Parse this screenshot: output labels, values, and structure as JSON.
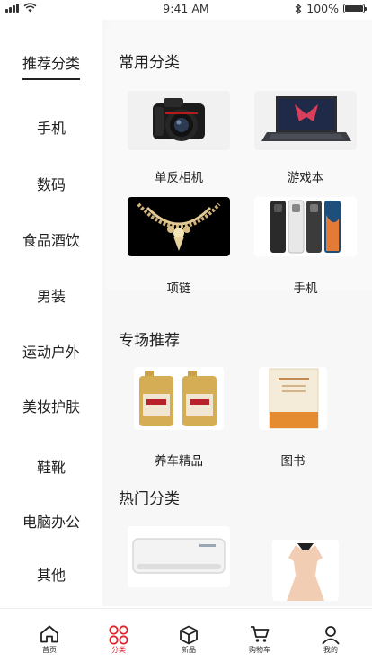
{
  "status_bar": {
    "time": "9:41 AM",
    "battery_percent": "100%",
    "battery_level": 1.0
  },
  "sidebar": {
    "items": [
      {
        "label": "推荐分类",
        "active": true
      },
      {
        "label": "手机"
      },
      {
        "label": "数码"
      },
      {
        "label": "食品酒饮"
      },
      {
        "label": "男装"
      },
      {
        "label": "运动户外"
      },
      {
        "label": "美妆护肤"
      },
      {
        "label": "鞋靴"
      },
      {
        "label": "电脑办公"
      },
      {
        "label": "其他"
      }
    ]
  },
  "sections": {
    "common": {
      "title": "常用分类",
      "items": [
        {
          "label": "单反相机",
          "icon": "camera-image"
        },
        {
          "label": "游戏本",
          "icon": "laptop-image"
        },
        {
          "label": "项链",
          "icon": "necklace-image"
        },
        {
          "label": "手机",
          "icon": "phone-image"
        }
      ]
    },
    "special": {
      "title": "专场推荐",
      "items": [
        {
          "label": "养车精品",
          "icon": "engine-oil-image"
        },
        {
          "label": "图书",
          "icon": "book-image"
        }
      ]
    },
    "hot": {
      "title": "热门分类",
      "items": [
        {
          "icon": "air-conditioner-image"
        },
        {
          "icon": "dress-image"
        }
      ]
    }
  },
  "tabbar": {
    "items": [
      {
        "label": "首页",
        "icon": "home-icon"
      },
      {
        "label": "分类",
        "icon": "category-icon",
        "active": true
      },
      {
        "label": "新品",
        "icon": "box-icon"
      },
      {
        "label": "购物车",
        "icon": "cart-icon"
      },
      {
        "label": "我的",
        "icon": "user-icon"
      }
    ]
  },
  "colors": {
    "accent": "#e0242b",
    "text": "#222222",
    "panel": "#f7f7f7"
  }
}
